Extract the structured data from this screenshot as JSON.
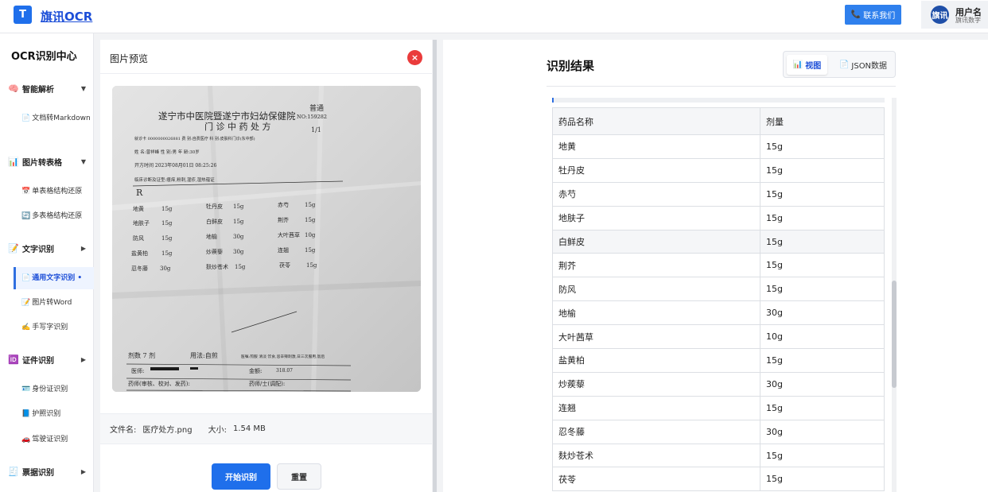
{
  "header": {
    "logo_letter": "T",
    "brand": "旗讯OCR",
    "contact_label": "联系我们",
    "user_avatar": "旗讯",
    "user_name": "用户名",
    "user_org": "旗讯数字"
  },
  "sidebar": {
    "title": "OCR识别中心",
    "groups": [
      {
        "icon": "🧠",
        "label": "智能解析",
        "arrow": "▼"
      },
      {
        "icon": "📊",
        "label": "图片转表格",
        "arrow": "▼"
      },
      {
        "icon": "📝",
        "label": "文字识别",
        "arrow": "▶"
      },
      {
        "icon": "🆔",
        "label": "证件识别",
        "arrow": "▶"
      },
      {
        "icon": "🧾",
        "label": "票据识别",
        "arrow": "▶"
      }
    ],
    "items": [
      {
        "icon": "📄",
        "label": "文档转Markdown"
      },
      {
        "icon": "📅",
        "label": "单表格结构还原"
      },
      {
        "icon": "🔄",
        "label": "多表格结构还原"
      },
      {
        "icon": "📄",
        "label": "通用文字识别",
        "active_mark": "•"
      },
      {
        "icon": "📝",
        "label": "图片转Word"
      },
      {
        "icon": "✍️",
        "label": "手写字识别"
      },
      {
        "icon": "🪪",
        "label": "身份证识别"
      },
      {
        "icon": "📘",
        "label": "护照识别"
      },
      {
        "icon": "🚗",
        "label": "驾驶证识别"
      }
    ]
  },
  "preview": {
    "title": "图片预览",
    "close_glyph": "×",
    "file_name_label": "文件名:",
    "file_name": "医疗处方.png",
    "file_size_label": "大小:",
    "file_size": "1.54 MB",
    "start_label": "开始识别",
    "reset_label": "重置",
    "doc": {
      "hospital": "遂宁市中医院暨遂宁市妇幼保健院",
      "form_title": "门 诊 中 药 处 方",
      "stamp": "普通",
      "no": "NO:159282",
      "page": "1/1",
      "fields1": "就诊卡 0000000026881    费 别:自费医疗 科 别:皮肤科门诊(东中部)",
      "fields2": "姓 名:曾祥峰    性 别:男    年 龄:30岁",
      "fields3": "开方时间  2023年08月01日 08:25:26",
      "diag": "临床诊断及证型:瘙痒,粉刺,湿疹,湿热蕴证",
      "rx": "R",
      "herbs": [
        [
          "地黄",
          "15g",
          "牡丹皮",
          "15g",
          "赤芍",
          "15g"
        ],
        [
          "地肤子",
          "15g",
          "白鲜皮",
          "15g",
          "荆芥",
          "15g"
        ],
        [
          "防风",
          "15g",
          "地榆",
          "30g",
          "大叶茜草",
          "10g"
        ],
        [
          "盐黄柏",
          "15g",
          "炒蒺藜",
          "30g",
          "连翘",
          "15g"
        ],
        [
          "忍冬藤",
          "30g",
          "麸炒苍术",
          "15g",
          "茯苓",
          "15g"
        ]
      ],
      "dose": "剂数 7 剂",
      "usage": "用法:自煎",
      "note": "医嘱:煎服 清淡 饮食,忌辛辣刺激,日三次服用,饭后",
      "doctor": "医师:",
      "amount": "金额:",
      "amount_value": "318.07",
      "pharm1": "药师(审核、校对、发药):",
      "pharm2": "药师/士(调配):"
    }
  },
  "result": {
    "title": "识别结果",
    "tab_view": "视图",
    "tab_json": "JSON数据",
    "columns": [
      "药品名称",
      "剂量"
    ],
    "rows": [
      [
        "地黄",
        "15g"
      ],
      [
        "牡丹皮",
        "15g"
      ],
      [
        "赤芍",
        "15g"
      ],
      [
        "地肤子",
        "15g"
      ],
      [
        "白鲜皮",
        "15g"
      ],
      [
        "荆芥",
        "15g"
      ],
      [
        "防风",
        "15g"
      ],
      [
        "地榆",
        "30g"
      ],
      [
        "大叶茜草",
        "10g"
      ],
      [
        "盐黄柏",
        "15g"
      ],
      [
        "炒蒺藜",
        "30g"
      ],
      [
        "连翘",
        "15g"
      ],
      [
        "忍冬藤",
        "30g"
      ],
      [
        "麸炒苍术",
        "15g"
      ],
      [
        "茯苓",
        "15g"
      ]
    ]
  }
}
